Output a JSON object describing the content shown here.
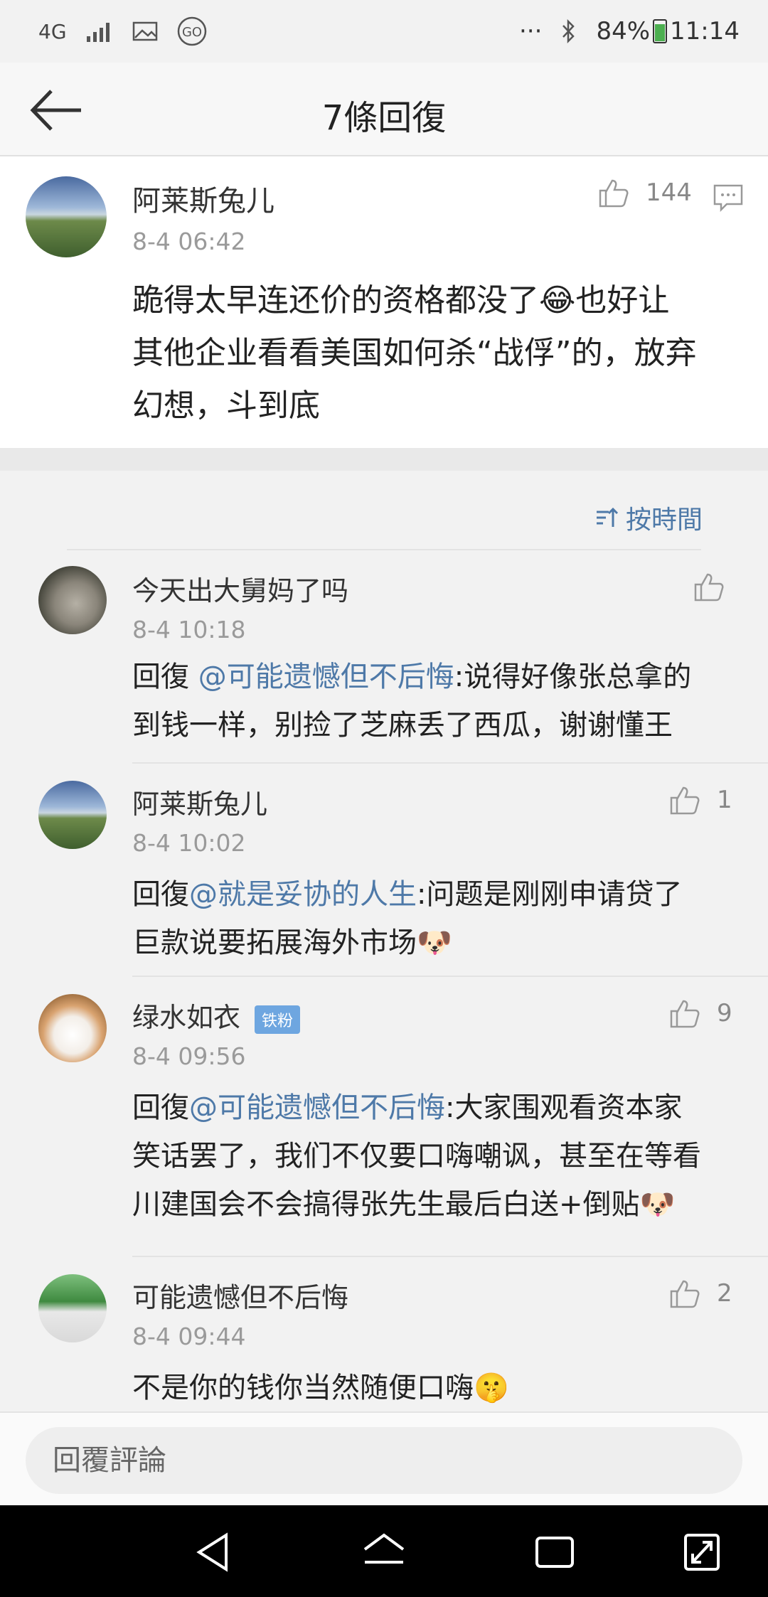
{
  "status_bar": {
    "network": "4G",
    "signal_icon": "signal-icon",
    "gallery_icon": "image-icon",
    "go_badge": "GO",
    "more": "···",
    "bluetooth_icon": "bluetooth-icon",
    "battery": "84%",
    "time": "11:14"
  },
  "header": {
    "title": "7條回復",
    "back_icon": "back-arrow-icon"
  },
  "root_comment": {
    "username": "阿莱斯兔儿",
    "time": "8-4 06:42",
    "likes": "144",
    "text_line1": "跪得太早连还价的资格都没了😂也好让",
    "text_line2": "其他企业看看美国如何杀“战俘”的，放弃",
    "text_line3": "幻想，斗到底"
  },
  "sort": {
    "label": "按時間"
  },
  "replies": [
    {
      "username": "今天出大舅妈了吗",
      "time": "8-4 10:18",
      "likes": "",
      "prefix": "回復 ",
      "mention": "@可能遗憾但不后悔",
      "line1_rest": ":说得好像张总拿的",
      "line2": "到钱一样，别捡了芝麻丢了西瓜，谢谢懂王"
    },
    {
      "username": "阿莱斯兔儿",
      "time": "8-4 10:02",
      "likes": "1",
      "prefix": "回復",
      "mention": "@就是妥协的人生",
      "line1_rest": ":问题是刚刚申请贷了",
      "line2": "巨款说要拓展海外市场🐶"
    },
    {
      "username": "绿水如衣",
      "badge": "铁粉",
      "time": "8-4 09:56",
      "likes": "9",
      "prefix": "回復",
      "mention": "@可能遗憾但不后悔",
      "line1_rest": ":大家围观看资本家",
      "line2": "笑话罢了，我们不仅要口嗨嘲讽，甚至在等看",
      "line3": "川建国会不会搞得张先生最后白送+倒贴🐶"
    },
    {
      "username": "可能遗憾但不后悔",
      "time": "8-4 09:44",
      "likes": "2",
      "line1": "不是你的钱你当然随便口嗨🤫"
    }
  ],
  "input": {
    "placeholder": "回覆評論"
  },
  "nav": {
    "back": "nav-back-icon",
    "home": "nav-home-icon",
    "recent": "nav-recents-icon",
    "extra": "nav-expand-icon"
  }
}
